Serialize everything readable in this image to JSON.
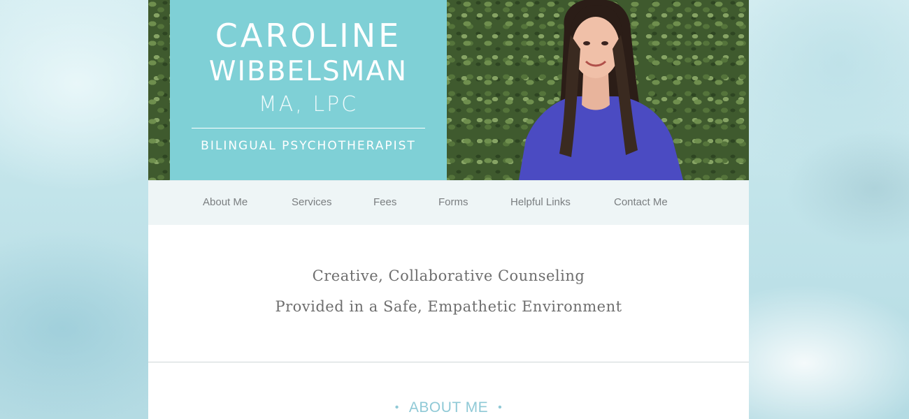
{
  "brand": {
    "name_line1": "CAROLINE",
    "name_line2": "WIBBELSMAN",
    "credentials": "MA, LPC",
    "tagline": "BILINGUAL PSYCHOTHERAPIST",
    "accent_color": "#7fd0d6"
  },
  "nav": {
    "items": [
      {
        "label": "About Me"
      },
      {
        "label": "Services"
      },
      {
        "label": "Fees"
      },
      {
        "label": "Forms"
      },
      {
        "label": "Helpful Links"
      },
      {
        "label": "Contact Me"
      }
    ]
  },
  "intro": {
    "line1": "Creative, Collaborative Counseling",
    "line2": "Provided in a Safe, Empathetic Environment"
  },
  "about": {
    "heading": "ABOUT ME",
    "bullet": "•"
  }
}
